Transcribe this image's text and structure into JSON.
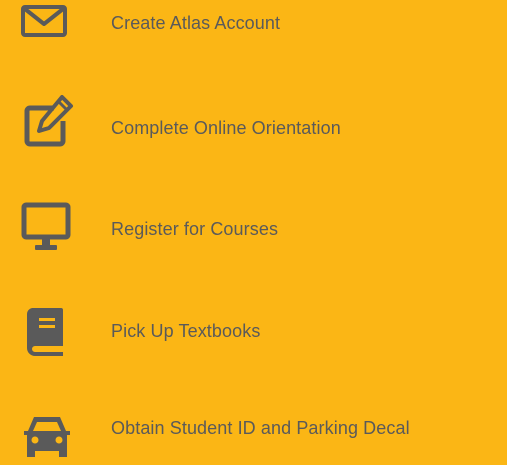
{
  "colors": {
    "background": "#FBB615",
    "icon": "#5A5A5A",
    "text": "#5A5A5A"
  },
  "steps": [
    {
      "icon": "envelope-icon",
      "label": "Create Atlas Account"
    },
    {
      "icon": "edit-icon",
      "label": "Complete Online Orientation"
    },
    {
      "icon": "monitor-icon",
      "label": "Register for Courses"
    },
    {
      "icon": "book-icon",
      "label": "Pick Up Textbooks"
    },
    {
      "icon": "car-icon",
      "label": "Obtain Student ID and Parking Decal"
    }
  ]
}
